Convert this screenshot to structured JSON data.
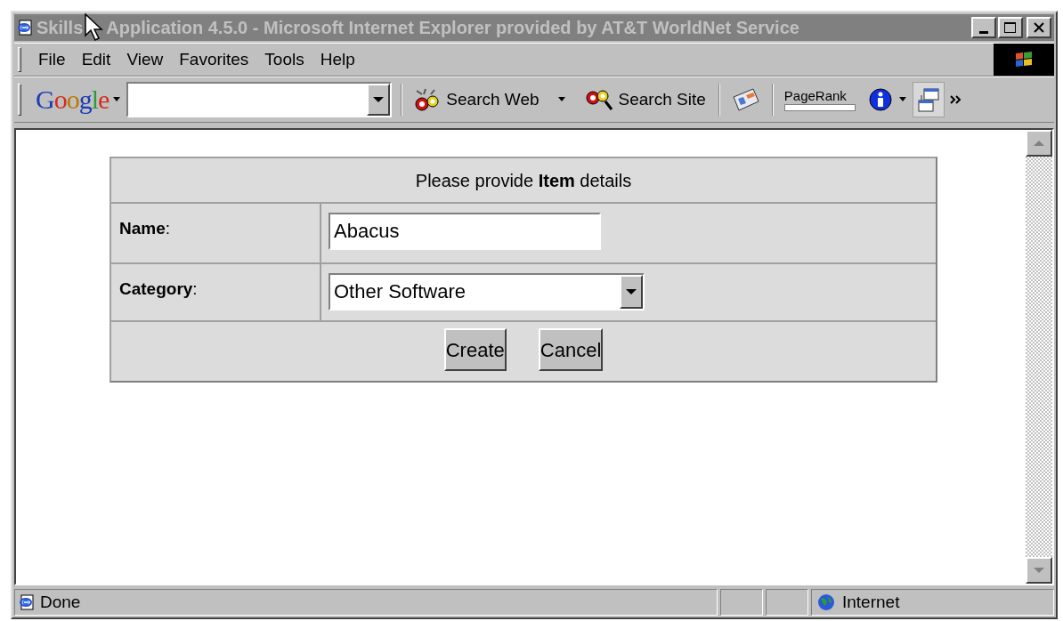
{
  "window": {
    "title": "Skills Application 4.5.0 - Microsoft Internet Explorer provided by AT&T WorldNet Service"
  },
  "menu": [
    "File",
    "Edit",
    "View",
    "Favorites",
    "Tools",
    "Help"
  ],
  "google_toolbar": {
    "logo": "Google",
    "buttons": [
      {
        "label": "Search Web",
        "kind": "web"
      },
      {
        "label": "Search Site",
        "kind": "site"
      }
    ],
    "pagerank_label": "PageRank"
  },
  "form": {
    "heading": "Please provide **Item** details",
    "fields": [
      {
        "label": "**Name**:",
        "kind": "text",
        "value": "Abacus"
      },
      {
        "label": "**Category**:",
        "kind": "select",
        "value": "Other Software"
      }
    ],
    "buttons": [
      "Create",
      "Cancel"
    ]
  },
  "status_bar": {
    "text": "Done",
    "zone": "Internet"
  }
}
